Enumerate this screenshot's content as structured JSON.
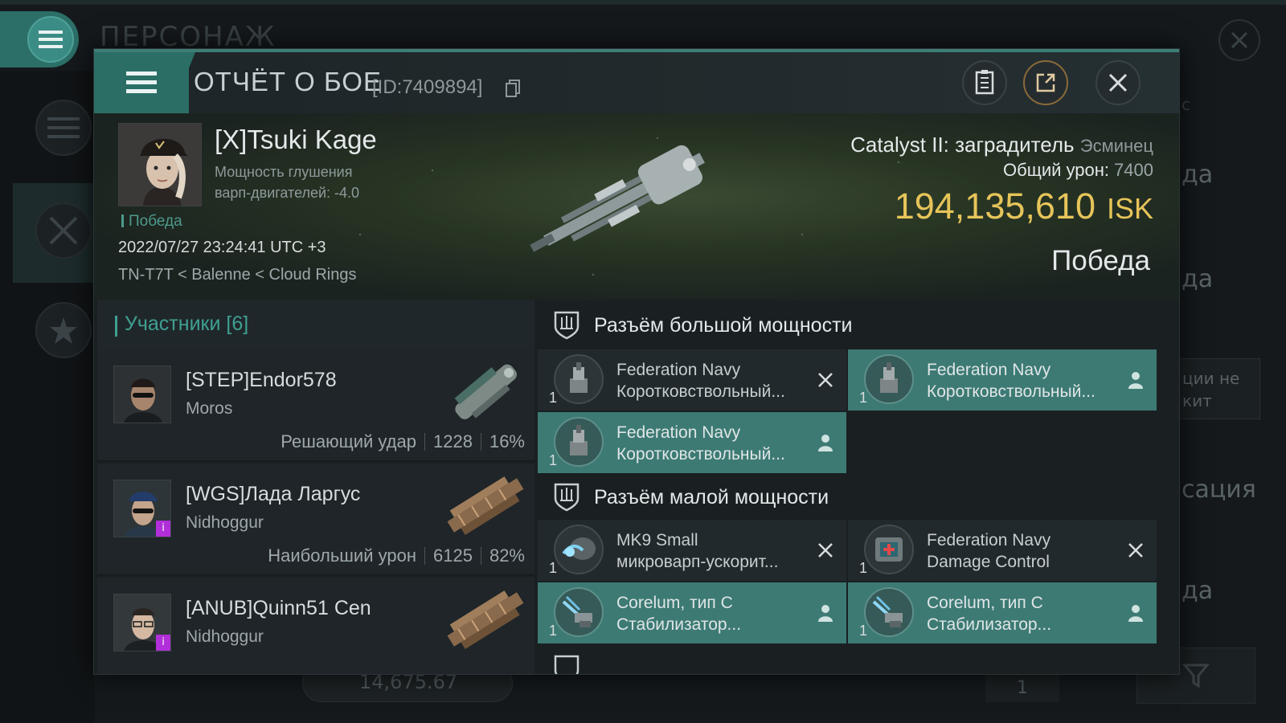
{
  "background": {
    "title": "ПЕРСОНАЖ",
    "right_texts": [
      "да",
      "да",
      "сация",
      "да"
    ],
    "right_box_text": "ции не\nкит",
    "right_top_faded": "с",
    "bottom_value": "14,675.67",
    "bottom_right_value": "1"
  },
  "report": {
    "title": "ОТЧЁТ О БОЕ",
    "id": "[ID:7409894]",
    "victim": {
      "name": "[X]Tsuki Kage",
      "stat_label": "Мощность глушения",
      "stat_line2": "варп-двигателей: -4.0",
      "result": "Победа",
      "datetime": "2022/07/27 23:24:41 UTC +3",
      "location": "TN-T7T < Balenne < Cloud Rings"
    },
    "ship": {
      "name": "Catalyst II: заградитель",
      "class": "Эсминец",
      "damage_label": "Общий урон:",
      "damage_value": "7400",
      "isk_value": "194,135,610",
      "isk_unit": "ISK",
      "outcome": "Победа"
    }
  },
  "participants": {
    "header": "Участники [6]",
    "rows": [
      {
        "name": "[STEP]Endor578",
        "ship": "Moros",
        "stat_label": "Решающий удар",
        "damage": "1228",
        "percent": "16%",
        "badge": ""
      },
      {
        "name": "[WGS]Лада Ларгус",
        "ship": "Nidhoggur",
        "stat_label": "Наибольший урон",
        "damage": "6125",
        "percent": "82%",
        "badge": "i"
      },
      {
        "name": "[ANUB]Quinn51 Cen",
        "ship": "Nidhoggur",
        "stat_label": "",
        "damage": "",
        "percent": "",
        "badge": "i"
      }
    ]
  },
  "fitting": {
    "high_slots_title": "Разъём большой мощности",
    "low_slots_title": "Разъём малой мощности",
    "high": [
      {
        "qty": "1",
        "line1": "Federation Navy",
        "line2": "Коротковствольный...",
        "state": "destroyed",
        "icon": "turret-icon"
      },
      {
        "qty": "1",
        "line1": "Federation Navy",
        "line2": "Коротковствольный...",
        "state": "dropped",
        "icon": "turret-icon"
      },
      {
        "qty": "1",
        "line1": "Federation Navy",
        "line2": "Коротковствольный...",
        "state": "dropped",
        "icon": "turret-icon"
      }
    ],
    "low": [
      {
        "qty": "1",
        "line1": "MK9 Small",
        "line2": "микроварп-ускорит...",
        "state": "destroyed",
        "icon": "microwarp-icon"
      },
      {
        "qty": "1",
        "line1": "Federation Navy",
        "line2": "Damage Control",
        "state": "destroyed",
        "icon": "damage-control-icon"
      },
      {
        "qty": "1",
        "line1": "Corelum, тип С",
        "line2": "Стабилизатор...",
        "state": "dropped",
        "icon": "stabilizer-icon"
      },
      {
        "qty": "1",
        "line1": "Corelum, тип С",
        "line2": "Стабилизатор...",
        "state": "dropped",
        "icon": "stabilizer-icon"
      }
    ]
  },
  "colors": {
    "accent_teal": "#3d7a74",
    "isk_gold": "#e7c45a",
    "result_green": "#4d9a8c"
  }
}
